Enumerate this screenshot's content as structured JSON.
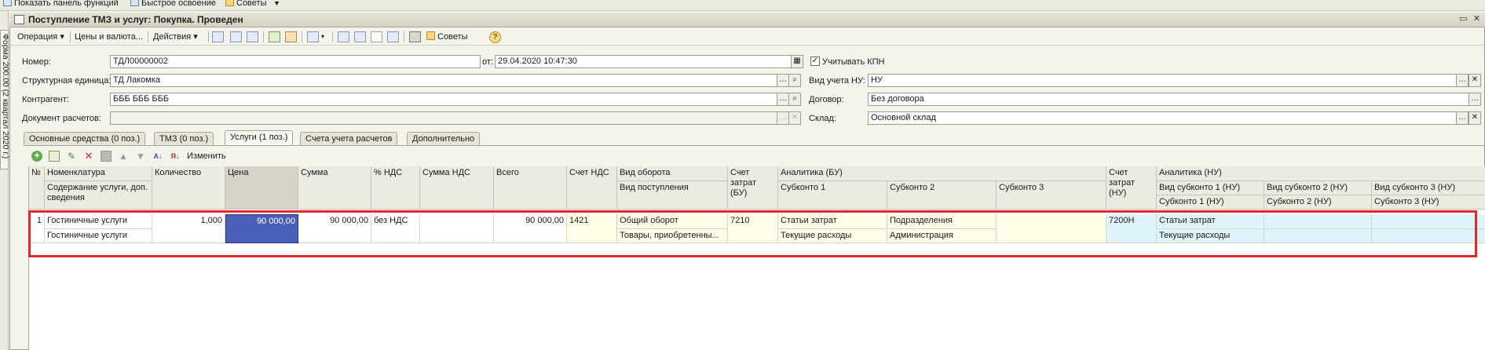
{
  "topbar": {
    "items": [
      {
        "label": "Показать панель функций",
        "icon": "panel-icon"
      },
      {
        "label": "Быстрое освоение",
        "icon": "learning-icon"
      },
      {
        "label": "Советы",
        "icon": "tips-icon"
      }
    ]
  },
  "side_tab": {
    "label": "Форма 200.00 (2 квартал 2020 г.)"
  },
  "window": {
    "title": "Поступление ТМЗ и услуг: Покупка. Проведен"
  },
  "toolbar": {
    "operation": "Операция",
    "prices": "Цены и валюта...",
    "actions": "Действия",
    "tips": "Советы"
  },
  "form": {
    "number_label": "Номер:",
    "number_value": "ТДЛ00000002",
    "date_label": "от:",
    "date_value": "29.04.2020 10:47:30",
    "kpn_label": "Учитывать КПН",
    "kpn_checked": "✓",
    "unit_label": "Структурная единица:",
    "unit_value": "ТД Лакомка",
    "nu_label": "Вид учета НУ:",
    "nu_value": "НУ",
    "contractor_label": "Контрагент:",
    "contractor_value": "БББ БББ БББ",
    "contract_label": "Договор:",
    "contract_value": "Без договора",
    "doc_label": "Документ расчетов:",
    "doc_value": "",
    "warehouse_label": "Склад:",
    "warehouse_value": "Основной склад"
  },
  "tabs": [
    "Основные средства (0 поз.)",
    "ТМЗ (0 поз.)",
    "Услуги (1 поз.)",
    "Счета учета расчетов",
    "Дополнительно"
  ],
  "grid_toolbar": {
    "edit": "Изменить"
  },
  "table": {
    "headers": {
      "num": "№",
      "nomenclature": "Номенклатура",
      "content": "Содержание услуги, доп. сведения",
      "quantity": "Количество",
      "price": "Цена",
      "sum": "Сумма",
      "vat_pct": "% НДС",
      "vat_sum": "Сумма НДС",
      "total": "Всего",
      "vat_account": "Счет НДС",
      "turnover": "Вид оборота",
      "receipt": "Вид поступления",
      "cost_account": "Счет затрат (БУ)",
      "analytics_bu": "Аналитика (БУ)",
      "sub1": "Субконто 1",
      "sub2": "Субконто 2",
      "sub3": "Субконто 3",
      "cost_account_nu": "Счет затрат (НУ)",
      "analytics_nu": "Аналитика (НУ)",
      "kind_sub1_nu": "Вид субконто 1 (НУ)",
      "kind_sub2_nu": "Вид субконто 2 (НУ)",
      "kind_sub3_nu": "Вид субконто 3 (НУ)",
      "sub1_nu": "Субконто 1 (НУ)",
      "sub2_nu": "Субконто 2 (НУ)",
      "sub3_nu": "Субконто 3 (НУ)"
    },
    "row": {
      "num": "1",
      "nomenclature": "Гостиничные услуги",
      "content": "Гостиничные услуги",
      "quantity": "1,000",
      "price": "90 000,00",
      "sum": "90 000,00",
      "vat_pct": "без НДС",
      "vat_sum": "",
      "total": "90 000,00",
      "vat_account": "1421",
      "turnover": "Общий оборот",
      "receipt": "Товары, приобретенны...",
      "cost_account": "7210",
      "sub1_top": "Статьи затрат",
      "sub1_bottom": "Текущие расходы",
      "sub2_top": "Подразделения",
      "sub2_bottom": "Администрация",
      "sub3": "",
      "cost_account_nu": "7200Н",
      "nu_sub1_top": "Статьи затрат",
      "nu_sub1_bottom": "Текущие расходы"
    }
  },
  "colors": {
    "highlight": "#e0282e",
    "selected_cell": "#4a5fb8",
    "nu_cell": "#dff3fb",
    "yellow_cell": "#fffde8"
  }
}
